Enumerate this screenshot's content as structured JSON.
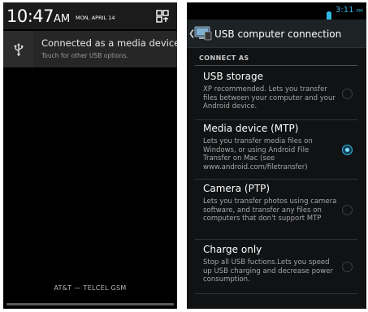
{
  "left": {
    "time": "10:47",
    "ampm": "AM",
    "date": "MON, APRIL 14",
    "notification": {
      "title": "Connected as a media device",
      "subtitle": "Touch for other USB options."
    },
    "carrier": "AT&T — TELCEL GSM",
    "icons": {
      "settings": "quick-settings-icon",
      "usb": "usb-icon"
    }
  },
  "right": {
    "status": {
      "time": "3:11",
      "ampm": "PM"
    },
    "title": "USB computer connection",
    "section_header": "CONNECT AS",
    "options": [
      {
        "title": "USB storage",
        "description": "XP recommended. Lets you transfer files between your computer and your Android device.",
        "selected": false
      },
      {
        "title": "Media device (MTP)",
        "description": "Lets you transfer media files on Windows, or using Android File Transfer on Mac (see www.android.com/filetransfer)",
        "selected": true
      },
      {
        "title": "Camera (PTP)",
        "description": "Lets you transfer photos using camera software, and transfer any files on computers that don't support MTP",
        "selected": false
      },
      {
        "title": "Charge only",
        "description": "Stop all USB fuctions.Lets you speed up USB charging and decrease power consumption.",
        "selected": false
      }
    ],
    "colors": {
      "accent": "#33b5e5",
      "background": "#101214",
      "action_bar": "#1d2225"
    }
  }
}
